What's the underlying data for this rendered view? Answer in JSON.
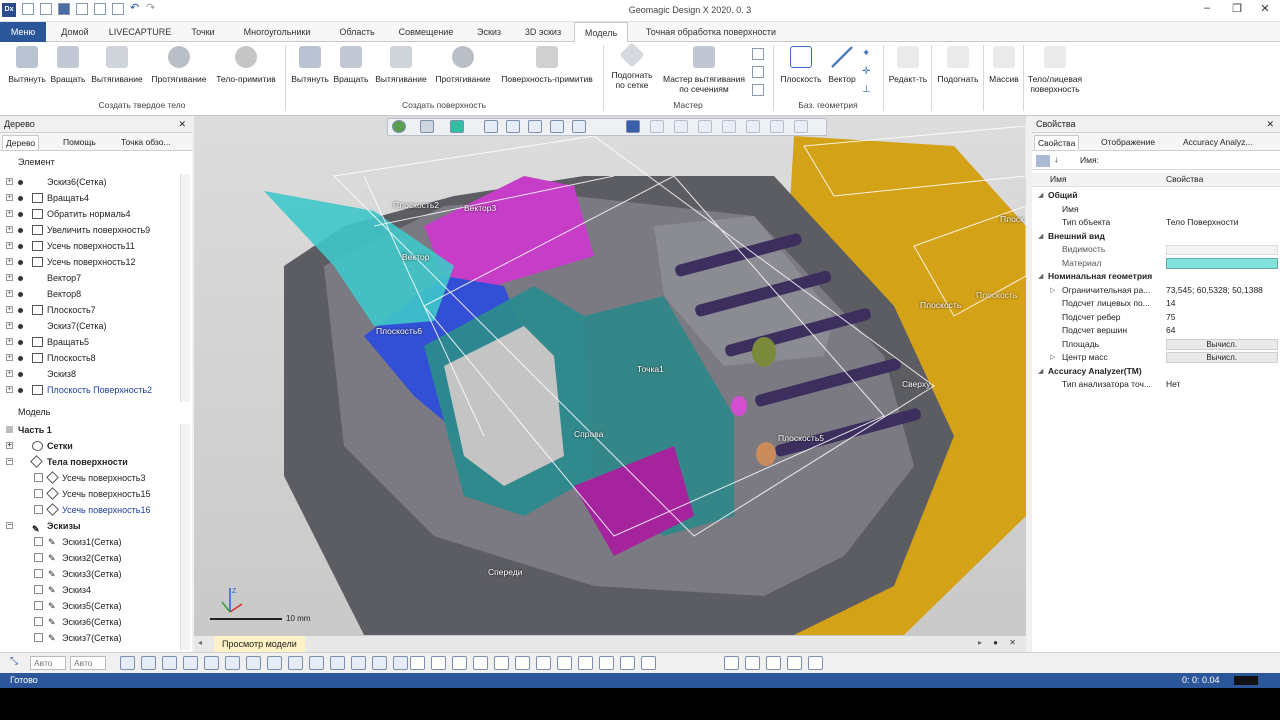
{
  "window": {
    "title": "Geomagic Design X 2020. 0. 3",
    "app_icon": "Dx"
  },
  "tabs": [
    "Меню",
    "Домой",
    "LIVECAPTURE",
    "Точки",
    "Многоугольники",
    "Область",
    "Совмещение",
    "Эскиз",
    "3D эскиз",
    "Модель",
    "Точная обработка поверхности"
  ],
  "ribbon": {
    "solid": [
      "Вытянуть",
      "Вращать",
      "Вытягивание",
      "Протягивание",
      "Тело-примитив"
    ],
    "solid_group": "Создать твердое тело",
    "surface": [
      "Вытянуть",
      "Вращать",
      "Вытягивание",
      "Протягивание",
      "Поверхность-примитив"
    ],
    "surface_group": "Создать поверхность",
    "wizard_1": "Подогнать по сетке",
    "wizard_2": "Мастер вытягивания по сечениям",
    "wizard_group": "Мастер",
    "ref_plane": "Плоскость",
    "ref_vector": "Вектор",
    "ref_group": "Баз. геометрия",
    "edit": "Редакт-ть",
    "fit": "Подогнать",
    "array": "Массив",
    "body_face": "Тело/лицевая поверхность"
  },
  "tree_panel": {
    "title": "Дерево",
    "tabs": [
      "Дерево",
      "Помощь",
      "Точка обзо..."
    ],
    "section_element": "Элемент",
    "elements": [
      "Эскиз6(Сетка)",
      "Вращать4",
      "Обратить нормаль4",
      "Увеличить поверхность9",
      "Усечь поверхность11",
      "Усечь поверхность12",
      "Вектор7",
      "Вектор8",
      "Плоскость7",
      "Эскиз7(Сетка)",
      "Вращать5",
      "Плоскость8",
      "Эскиз8",
      "Плоскость Поверхность2"
    ],
    "section_model": "Модель",
    "part": "Часть 1",
    "meshes": "Сетки",
    "bodies": "Тела поверхности",
    "bodies_items": [
      "Усечь поверхность3",
      "Усечь поверхность15",
      "Усечь поверхность16"
    ],
    "sketches": "Эскизы",
    "sketch_items": [
      "Эскиз1(Сетка)",
      "Эскиз2(Сетка)",
      "Эскиз3(Сетка)",
      "Эскиз4",
      "Эскиз5(Сетка)",
      "Эскиз6(Сетка)",
      "Эскиз7(Сетка)"
    ]
  },
  "viewport": {
    "labels": {
      "plane2": "Плоскость2",
      "vector3": "Вектор3",
      "vector": "Вектор",
      "plane6": "Плоскость6",
      "plane": "Плоскость",
      "point1": "Точка1",
      "right": "Справа",
      "plane5": "Плоскость5",
      "top": "Сверху",
      "front": "Спереди",
      "plane_top": "Плоск",
      "plane_far": "Плоскость"
    },
    "scale": "10 mm",
    "axis_z": "Z"
  },
  "view_strip": {
    "label": "Просмотр модели"
  },
  "bottom": {
    "auto1": "Авто",
    "auto2": "Авто"
  },
  "properties": {
    "title": "Свойства",
    "tabs": [
      "Свойства",
      "Отображение",
      "Accuracy Analyz..."
    ],
    "name_label": "Имя:",
    "col_name": "Имя",
    "col_props": "Свойства",
    "cat_general": "Общий",
    "name_key": "Имя",
    "type_key": "Тип объекта",
    "type_val": "Тело Поверхности",
    "cat_appearance": "Внешний вид",
    "visibility": "Видимость",
    "material": "Материал",
    "material_color": "#7fe3dc",
    "cat_geometry": "Номинальная геометрия",
    "bbox_key": "Ограничительная ра...",
    "bbox_val": "73,545; 60,5328; 50,1388",
    "faces_key": "Подсчет лицевых по...",
    "faces_val": "14",
    "edges_key": "Подсчет ребер",
    "edges_val": "75",
    "verts_key": "Подсчет вершин",
    "verts_val": "64",
    "area_key": "Площадь",
    "area_btn": "Вычисл.",
    "center_key": "Центр масс",
    "center_btn": "Вычисл.",
    "cat_accuracy": "Accuracy Analyzer(TM)",
    "analyzer_key": "Тип анализатора точ...",
    "analyzer_val": "Нет"
  },
  "status": {
    "text": "Готово",
    "time": "0: 0: 0.04"
  },
  "colors": {
    "accent": "#2b579a",
    "ribbon_icon": "#c8cfd9"
  }
}
